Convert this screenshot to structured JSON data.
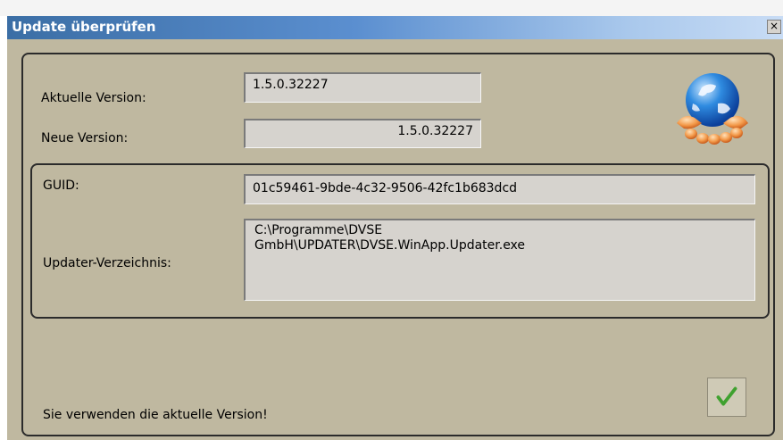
{
  "window": {
    "title": "Update überprüfen",
    "close_label": "×"
  },
  "version": {
    "current_label": "Aktuelle Version:",
    "current_value": "1.5.0.32227",
    "new_label": "Neue Version:",
    "new_value": "1.5.0.32227"
  },
  "details": {
    "guid_label": "GUID:",
    "guid_value": "01c59461-9bde-4c32-9506-42fc1b683dcd",
    "dir_label": "Updater-Verzeichnis:",
    "dir_value": "C:\\Programme\\DVSE\nGmbH\\UPDATER\\DVSE.WinApp.Updater.exe"
  },
  "status": {
    "message": "Sie verwenden die aktuelle Version!"
  },
  "icons": {
    "globe": "globe-in-hands-icon",
    "ok": "checkmark-icon"
  },
  "colors": {
    "titlebar_start": "#3b6ea5",
    "client_bg": "#bfb8a0",
    "field_bg": "#d6d3ce",
    "check_green": "#3fa12f"
  }
}
